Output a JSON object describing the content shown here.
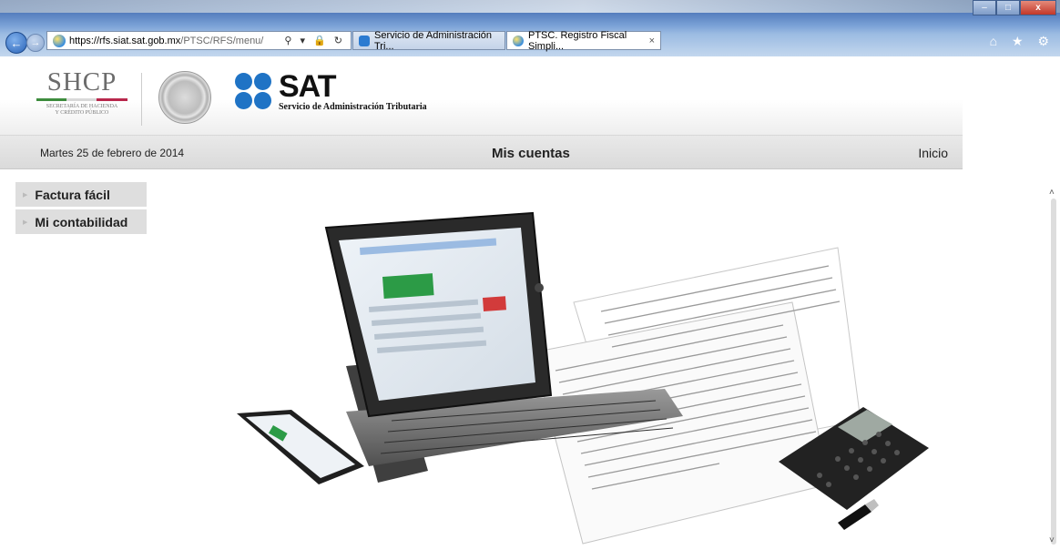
{
  "browser": {
    "url_bold": "https://rfs.siat.sat.gob.mx",
    "url_rest": "/PTSC/RFS/menu/",
    "addr_tools": "⚲ ▾ 🔒 ↻",
    "tabs": [
      {
        "title": "Servicio de Administración Tri...",
        "active": false
      },
      {
        "title": "PTSC. Registro Fiscal Simpli...",
        "close": "×",
        "active": true
      }
    ],
    "window_controls": {
      "minimize": "–",
      "maximize": "□",
      "close": "x"
    },
    "toolbar_icons": "⌂ ★ ⚙"
  },
  "header": {
    "shcp_title": "SHCP",
    "shcp_subtitle_1": "SECRETARÍA DE HACIENDA",
    "shcp_subtitle_2": "Y CRÉDITO PÚBLICO",
    "sat_title": "SAT",
    "sat_subtitle": "Servicio de Administración Tributaria"
  },
  "menubar": {
    "date": "Martes 25 de febrero de 2014",
    "section_title": "Mis cuentas",
    "home_link": "Inicio"
  },
  "sidebar": {
    "items": [
      {
        "label": "Factura fácil"
      },
      {
        "label": "Mi contabilidad"
      }
    ]
  },
  "colors": {
    "brand_blue": "#1f73c5",
    "menubar_bg": "#dadada",
    "sidebar_bg": "#dedede"
  }
}
